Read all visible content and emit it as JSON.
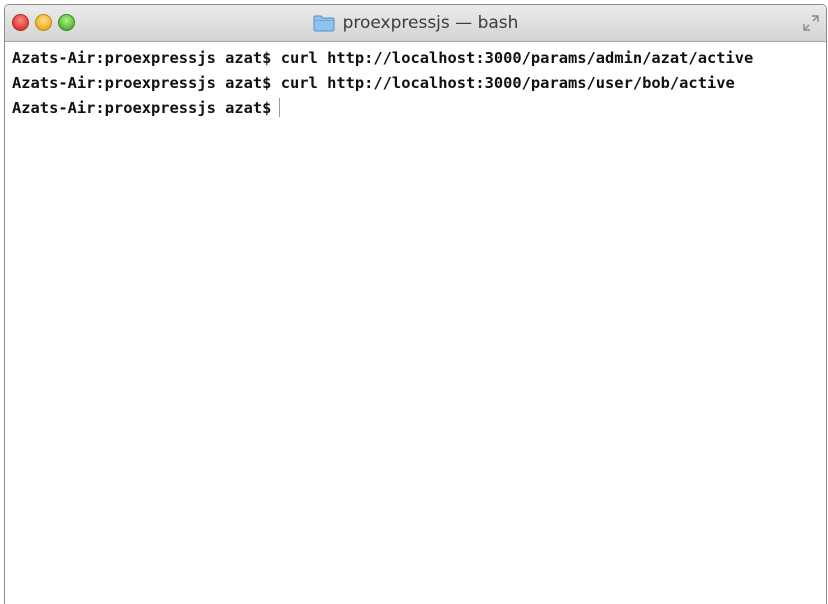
{
  "window": {
    "title": "proexpressjs — bash",
    "title_icon": "folder-icon"
  },
  "terminal": {
    "lines": [
      {
        "prompt": "Azats-Air:proexpressjs azat$",
        "command": "curl http://localhost:3000/params/admin/azat/active"
      },
      {
        "prompt": "Azats-Air:proexpressjs azat$",
        "command": "curl http://localhost:3000/params/user/bob/active"
      },
      {
        "prompt": "Azats-Air:proexpressjs azat$",
        "command": ""
      }
    ]
  },
  "colors": {
    "close": "#e0443e",
    "minimize": "#f3b531",
    "maximize": "#5fc33a",
    "folder": "#7fb8e6"
  }
}
